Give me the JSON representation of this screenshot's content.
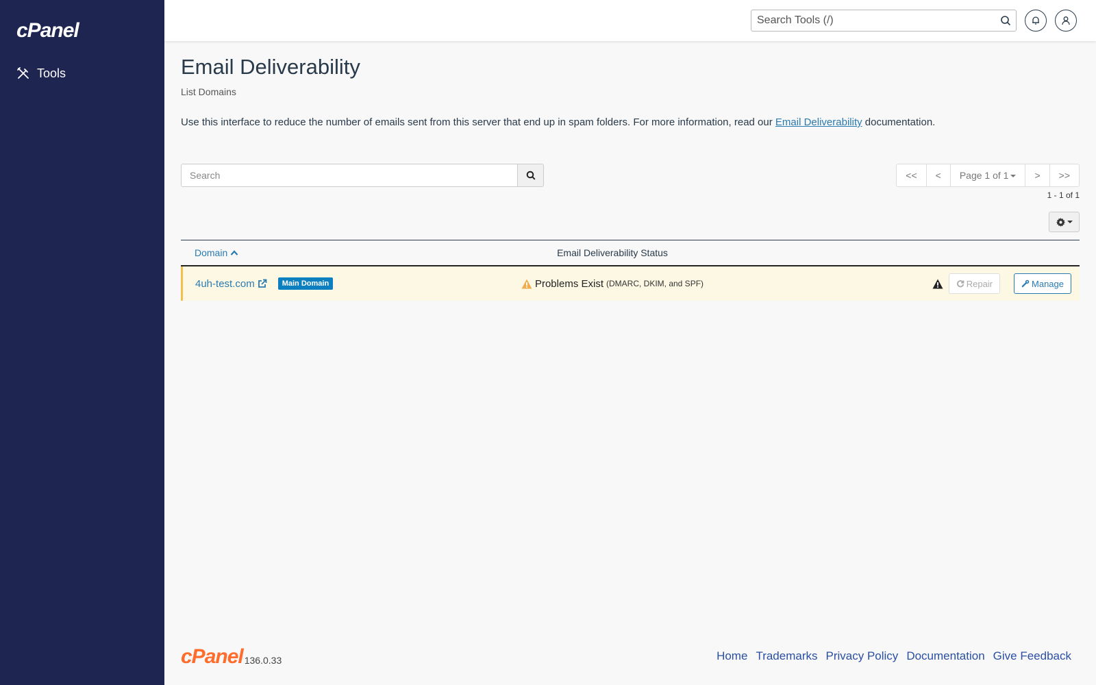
{
  "app": {
    "brand": "cPanel"
  },
  "sidebar": {
    "items": [
      {
        "label": "Tools",
        "icon": "tools-icon"
      }
    ]
  },
  "topbar": {
    "search_placeholder": "Search Tools (/)"
  },
  "page": {
    "title": "Email Deliverability",
    "subtitle": "List Domains",
    "intro_before": "Use this interface to reduce the number of emails sent from this server that end up in spam folders. For more information, read our ",
    "intro_link": "Email Deliverability",
    "intro_after": " documentation."
  },
  "list": {
    "search_placeholder": "Search",
    "pager": {
      "first": "<<",
      "prev": "<",
      "page_label": "Page 1 of 1",
      "next": ">",
      "last": ">>"
    },
    "range_text": "1 - 1 of 1"
  },
  "table": {
    "columns": {
      "domain": "Domain",
      "status": "Email Deliverability Status"
    },
    "rows": [
      {
        "domain": "4uh-test.com",
        "badge": "Main Domain",
        "status_main": "Problems Exist",
        "status_detail": "(DMARC, DKIM, and SPF)",
        "repair_label": "Repair",
        "manage_label": "Manage"
      }
    ]
  },
  "footer": {
    "brand": "cPanel",
    "version": "136.0.33",
    "links": [
      "Home",
      "Trademarks",
      "Privacy Policy",
      "Documentation",
      "Give Feedback"
    ]
  },
  "colors": {
    "sidebar": "#1f2551",
    "link": "#2a7ab0",
    "warning": "#f0ad4e",
    "row_highlight": "#fcf8e3",
    "footer_logo": "#ff6c2c"
  }
}
